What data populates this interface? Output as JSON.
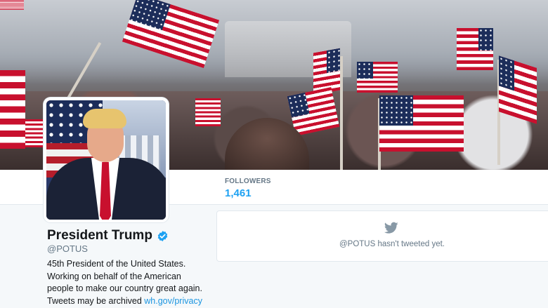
{
  "profile": {
    "name": "President Trump",
    "handle": "@POTUS",
    "bio_lines": [
      "45th President of the United States.",
      "Working on behalf of the American",
      "people to make our country great again.",
      "Tweets may be archived"
    ],
    "bio_link": "wh.gov/privacy",
    "verified": true
  },
  "nav": {
    "followers_label": "FOLLOWERS",
    "followers_count": "1,461"
  },
  "timeline": {
    "empty_message": "@POTUS hasn't tweeted yet."
  },
  "colors": {
    "accent": "#1da1f2",
    "link": "#1b95e0",
    "muted_text": "#657786",
    "verified": "#1da1f2"
  },
  "icons": {
    "verified": "verified-badge-icon",
    "bird": "twitter-bird-icon"
  }
}
